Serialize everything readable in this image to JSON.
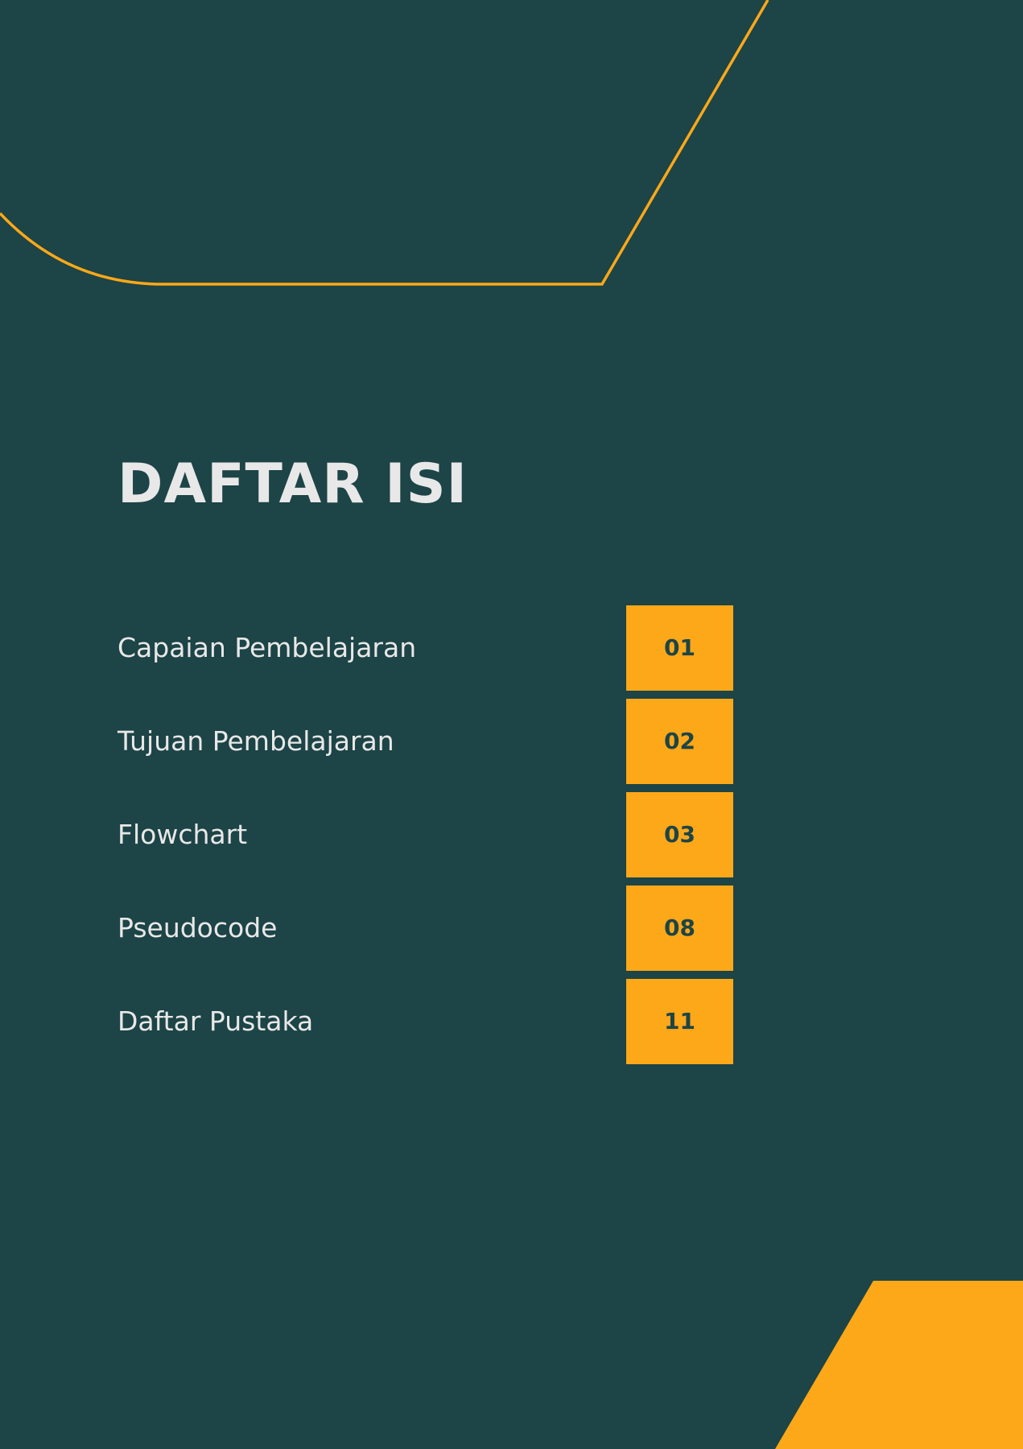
{
  "document": {
    "title": "DAFTAR ISI"
  },
  "toc": {
    "items": [
      {
        "label": "Capaian Pembelajaran",
        "page": "01"
      },
      {
        "label": "Tujuan Pembelajaran",
        "page": "02"
      },
      {
        "label": "Flowchart",
        "page": "03"
      },
      {
        "label": "Pseudocode",
        "page": "08"
      },
      {
        "label": "Daftar Pustaka",
        "page": "11"
      }
    ]
  },
  "colors": {
    "background": "#1d4446",
    "accent": "#fca819",
    "text": "#e8e8e8"
  }
}
